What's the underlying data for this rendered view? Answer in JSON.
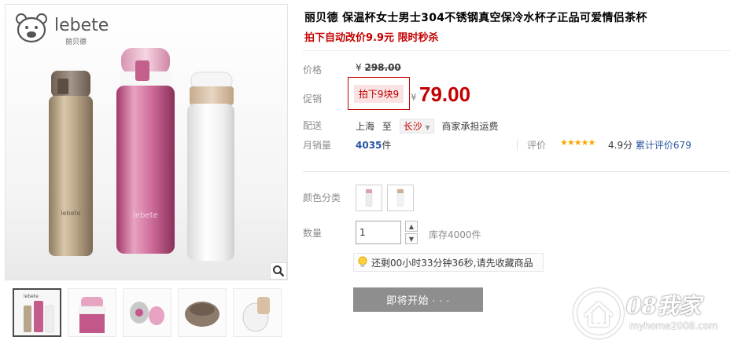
{
  "brand": {
    "name": "lebete",
    "sub": "丽贝德"
  },
  "product": {
    "title": "丽贝德 保温杯女士男士304不锈钢真空保冷水杯子正品可爱情侣茶杯",
    "subtitle": "拍下自动改价9.9元 限时秒杀"
  },
  "price": {
    "label": "价格",
    "currency": "¥",
    "original": "298.00",
    "promo_label": "促销",
    "promo_tag": "拍下9块9",
    "promo_price": "79.00"
  },
  "shipping": {
    "label": "配送",
    "from": "上海",
    "to_word": "至",
    "city": "长沙",
    "fee": "商家承担运费"
  },
  "sales": {
    "label": "月销量",
    "count": "4035",
    "unit": "件",
    "rating_label": "评价",
    "stars": "★★★★★",
    "score": "4.9分",
    "reviews": "累计评价679"
  },
  "options": {
    "color_label": "颜色分类",
    "qty_label": "数量",
    "qty_value": "1",
    "stock": "库存4000件"
  },
  "tip": {
    "text": "还剩00小时33分钟36秒,请先收藏商品"
  },
  "cta": {
    "label": "即将开始 · · ·"
  },
  "watermark": {
    "text": "08我家",
    "url": "myhome2008.com"
  },
  "colors": {
    "accent": "#c40000",
    "link": "#2856a0",
    "star": "#f7a800",
    "button": "#8e8e8e"
  }
}
